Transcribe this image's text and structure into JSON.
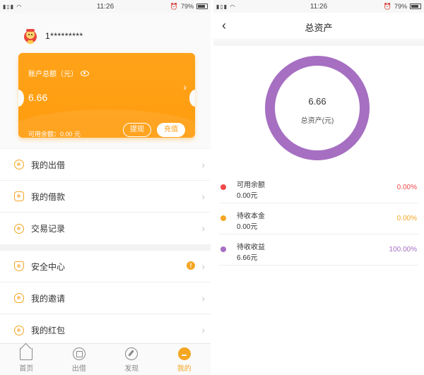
{
  "colors": {
    "accent": "#f5a623",
    "card": "#ffa31a",
    "red": "#f04848",
    "orange": "#f5a623",
    "purple": "#a66fc2"
  },
  "status": {
    "signal": "᷊ıll ᷊ıll",
    "time": "11:26",
    "battery": "79%"
  },
  "left": {
    "profile": {
      "phone": "1*********"
    },
    "card": {
      "label": "账户总额（元）",
      "amount": "6.66",
      "balance": "可用余额：0.00 元",
      "withdraw": "提现",
      "recharge": "充值"
    },
    "menu_group1": [
      {
        "label": "我的出借",
        "icon": "lend-icon"
      },
      {
        "label": "我的借款",
        "icon": "loan-icon"
      },
      {
        "label": "交易记录",
        "icon": "record-icon"
      }
    ],
    "menu_group2": [
      {
        "label": "安全中心",
        "icon": "shield-icon",
        "badge": "!"
      },
      {
        "label": "我的邀请",
        "icon": "invite-icon"
      },
      {
        "label": "我的红包",
        "icon": "redpacket-icon"
      }
    ],
    "tabs": [
      {
        "label": "首页",
        "icon": "home-icon"
      },
      {
        "label": "出借",
        "icon": "lend-tab-icon"
      },
      {
        "label": "发现",
        "icon": "compass-icon"
      },
      {
        "label": "我的",
        "icon": "mine-icon",
        "active": true
      }
    ]
  },
  "right": {
    "title": "总资产",
    "total": "6.66",
    "total_label": "总资产(元)",
    "legend": [
      {
        "name": "可用余额",
        "amount": "0.00元",
        "percent": "0.00%",
        "color": "#f04848",
        "value": 0
      },
      {
        "name": "待收本金",
        "amount": "0.00元",
        "percent": "0.00%",
        "color": "#f5a623",
        "value": 0
      },
      {
        "name": "待收收益",
        "amount": "6.66元",
        "percent": "100.00%",
        "color": "#a66fc2",
        "value": 100
      }
    ]
  }
}
